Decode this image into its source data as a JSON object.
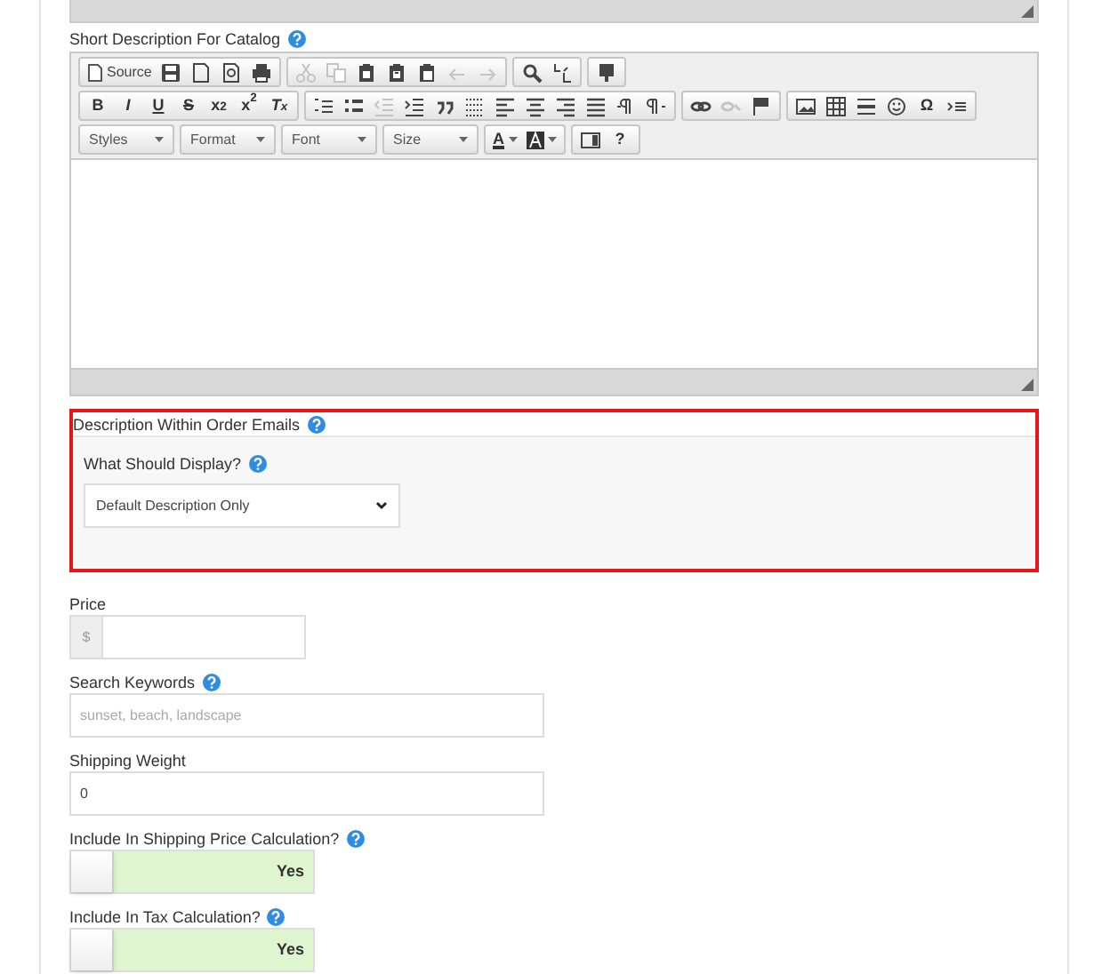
{
  "short_description": {
    "label": "Short Description For Catalog",
    "help": true,
    "toolbar": [
      [
        [
          {
            "kind": "source",
            "label": "Source"
          },
          {
            "kind": "icon",
            "disabled": false
          },
          {
            "kind": "icon",
            "disabled": false
          },
          {
            "kind": "icon",
            "disabled": false
          },
          {
            "kind": "icon",
            "disabled": false
          }
        ],
        [
          {
            "kind": "icon",
            "disabled": true
          },
          {
            "kind": "icon",
            "disabled": true
          },
          {
            "kind": "icon",
            "disabled": false
          },
          {
            "kind": "icon",
            "disabled": false
          },
          {
            "kind": "icon",
            "disabled": false
          },
          {
            "kind": "icon",
            "disabled": true
          },
          {
            "kind": "icon",
            "disabled": true
          }
        ],
        [
          {
            "kind": "icon",
            "disabled": false
          },
          {
            "kind": "icon",
            "disabled": false
          }
        ],
        [
          {
            "kind": "icon",
            "disabled": false
          }
        ]
      ],
      [
        [
          {
            "kind": "text",
            "label": "B"
          },
          {
            "kind": "text",
            "label": "I"
          },
          {
            "kind": "text",
            "label": "U"
          },
          {
            "kind": "text",
            "label": "S"
          },
          {
            "kind": "text",
            "label": "x$_{2}$"
          },
          {
            "kind": "text",
            "label": "x$^{2}$"
          },
          {
            "kind": "text",
            "label": "T$_{x}$"
          }
        ],
        [
          {
            "kind": "icon",
            "disabled": false
          },
          {
            "kind": "icon",
            "disabled": false
          },
          {
            "kind": "icon",
            "disabled": true
          },
          {
            "kind": "icon",
            "disabled": false
          },
          {
            "kind": "icon",
            "disabled": false
          },
          {
            "kind": "icon",
            "disabled": false
          },
          {
            "kind": "icon",
            "disabled": false
          },
          {
            "kind": "icon",
            "disabled": false
          },
          {
            "kind": "icon",
            "disabled": false
          },
          {
            "kind": "icon",
            "disabled": false
          },
          {
            "kind": "icon",
            "disabled": false
          },
          {
            "kind": "icon",
            "disabled": false
          }
        ],
        [
          {
            "kind": "icon",
            "disabled": false
          },
          {
            "kind": "icon",
            "disabled": true
          },
          {
            "kind": "icon",
            "disabled": false
          }
        ],
        [
          {
            "kind": "icon",
            "disabled": false
          },
          {
            "kind": "icon",
            "disabled": false
          },
          {
            "kind": "icon",
            "disabled": false
          },
          {
            "kind": "icon",
            "disabled": false
          },
          {
            "kind": "text",
            "label": "Ω"
          },
          {
            "kind": "icon",
            "disabled": false
          }
        ]
      ],
      [
        [
          {
            "kind": "combo",
            "label": "Styles"
          }
        ],
        [
          {
            "kind": "combo",
            "label": "Format"
          }
        ],
        [
          {
            "kind": "combo",
            "label": "Font"
          }
        ],
        [
          {
            "kind": "combo",
            "label": "Size"
          }
        ],
        [
          {
            "kind": "color",
            "label": "A"
          },
          {
            "kind": "iconcolor"
          }
        ],
        [
          {
            "kind": "icon",
            "disabled": false
          },
          {
            "kind": "text",
            "label": "?"
          }
        ]
      ]
    ]
  },
  "order_emails": {
    "title": "Description Within Order Emails",
    "help": true,
    "field_label": "What Should Display?",
    "field_help": true,
    "select_value": "Default Description Only"
  },
  "fields": [
    {
      "kind": "price",
      "label": "Price",
      "addon": "$",
      "help": false
    },
    {
      "kind": "input",
      "label": "Search Keywords",
      "help": true,
      "placeholder": "sunset, beach, landscape"
    },
    {
      "kind": "input",
      "label": "Shipping Weight",
      "help": false,
      "value": "0"
    },
    {
      "kind": "toggle",
      "label": "Include In Shipping Price Calculation?",
      "help": true,
      "on": true,
      "text": "Yes"
    },
    {
      "kind": "toggle",
      "label": "Include In Tax Calculation?",
      "help": true,
      "on": true,
      "text": "Yes"
    }
  ]
}
